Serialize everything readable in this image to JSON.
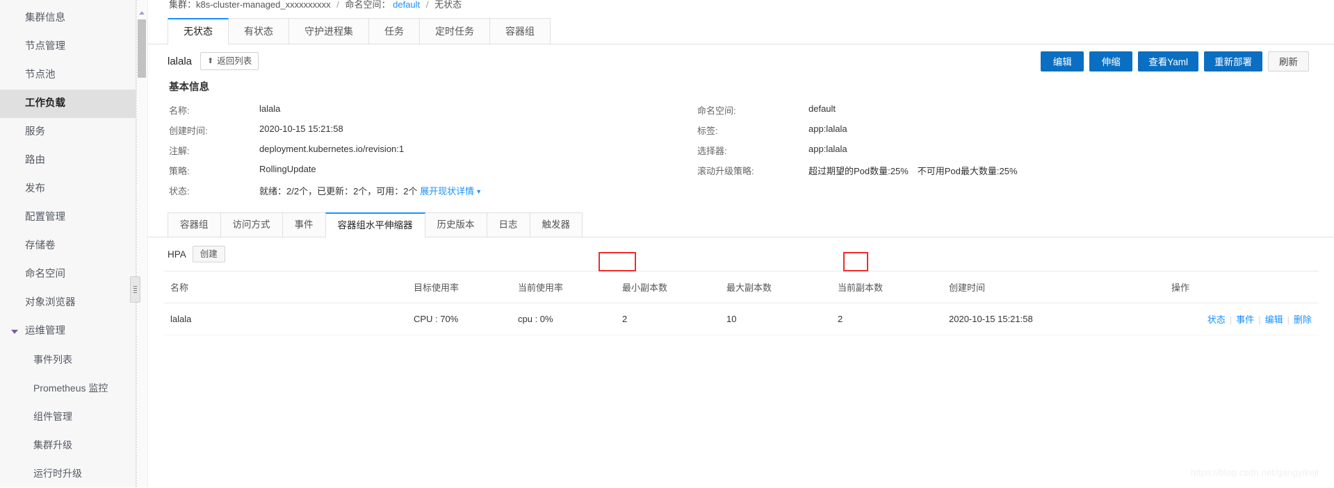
{
  "sidebar": {
    "items": [
      {
        "label": "集群信息",
        "level": "top",
        "active": false,
        "icon": null
      },
      {
        "label": "节点管理",
        "level": "top",
        "active": false,
        "icon": null
      },
      {
        "label": "节点池",
        "level": "top",
        "active": false,
        "icon": null
      },
      {
        "label": "工作负载",
        "level": "top",
        "active": true,
        "icon": null
      },
      {
        "label": "服务",
        "level": "top",
        "active": false,
        "icon": null
      },
      {
        "label": "路由",
        "level": "top",
        "active": false,
        "icon": null
      },
      {
        "label": "发布",
        "level": "top",
        "active": false,
        "icon": null
      },
      {
        "label": "配置管理",
        "level": "top",
        "active": false,
        "icon": null
      },
      {
        "label": "存储卷",
        "level": "top",
        "active": false,
        "icon": null
      },
      {
        "label": "命名空间",
        "level": "top",
        "active": false,
        "icon": null
      },
      {
        "label": "对象浏览器",
        "level": "top",
        "active": false,
        "icon": null
      },
      {
        "label": "运维管理",
        "level": "group",
        "active": false,
        "icon": "caret-down-icon"
      },
      {
        "label": "事件列表",
        "level": "child",
        "active": false,
        "icon": null
      },
      {
        "label": "Prometheus 监控",
        "level": "child",
        "active": false,
        "icon": null
      },
      {
        "label": "组件管理",
        "level": "child",
        "active": false,
        "icon": null
      },
      {
        "label": "集群升级",
        "level": "child",
        "active": false,
        "icon": null
      },
      {
        "label": "运行时升级",
        "level": "child",
        "active": false,
        "icon": null
      }
    ]
  },
  "breadcrumb": {
    "cluster": "集群：k8s-cluster-managed_xxxxxxxxxx",
    "sep1": "/",
    "namespace_label": "命名空间：",
    "namespace_link": "default",
    "sep2": "/",
    "page": "无状态"
  },
  "top_tabs": [
    {
      "label": "无状态",
      "active": true
    },
    {
      "label": "有状态",
      "active": false
    },
    {
      "label": "守护进程集",
      "active": false
    },
    {
      "label": "任务",
      "active": false
    },
    {
      "label": "定时任务",
      "active": false
    },
    {
      "label": "容器组",
      "active": false
    }
  ],
  "workload": {
    "title": "lalala",
    "back_button": "返回列表",
    "back_icon": "up-arrow-icon"
  },
  "actions": {
    "edit": "编辑",
    "scale": "伸缩",
    "view_yaml": "查看Yaml",
    "redeploy": "重新部署",
    "refresh": "刷新"
  },
  "basic_info": {
    "section_title": "基本信息",
    "left": [
      {
        "label": "名称:",
        "value": "lalala"
      },
      {
        "label": "创建时间:",
        "value": "2020-10-15 15:21:58"
      },
      {
        "label": "注解:",
        "value": "deployment.kubernetes.io/revision:1"
      },
      {
        "label": "策略:",
        "value": "RollingUpdate"
      }
    ],
    "status": {
      "label": "状态:",
      "value": "就绪：2/2个，已更新：2个，可用：2个",
      "link": "展开现状详情",
      "link_icon": "chevron-down-icon"
    },
    "right": [
      {
        "label": "命名空间:",
        "value": "default"
      },
      {
        "label": "标签:",
        "value": "app:lalala"
      },
      {
        "label": "选择器:",
        "value": "app:lalala"
      },
      {
        "label": "滚动升级策略:",
        "value": "超过期望的Pod数量:25%　不可用Pod最大数量:25%"
      }
    ]
  },
  "inner_tabs": [
    {
      "label": "容器组",
      "active": false
    },
    {
      "label": "访问方式",
      "active": false
    },
    {
      "label": "事件",
      "active": false
    },
    {
      "label": "容器组水平伸缩器",
      "active": true
    },
    {
      "label": "历史版本",
      "active": false
    },
    {
      "label": "日志",
      "active": false
    },
    {
      "label": "触发器",
      "active": false
    }
  ],
  "hpa": {
    "label": "HPA",
    "create_button": "创建",
    "columns": {
      "name": "名称",
      "target_usage": "目标使用率",
      "current_usage": "当前使用率",
      "min_replicas": "最小副本数",
      "max_replicas": "最大副本数",
      "current_replicas": "当前副本数",
      "created_at": "创建时间",
      "operations": "操作"
    },
    "rows": [
      {
        "name": "lalala",
        "target_usage": "CPU : 70%",
        "current_usage": "cpu : 0%",
        "min_replicas": "2",
        "max_replicas": "10",
        "current_replicas": "2",
        "created_at": "2020-10-15 15:21:58",
        "ops": [
          "状态",
          "事件",
          "编辑",
          "删除"
        ]
      }
    ]
  },
  "annotations": {
    "highlight_color": "#ef2b2b",
    "boxes": [
      "current_usage_cell",
      "current_replicas_cell"
    ]
  },
  "watermark": "https://blog.csdn.net/gangyikeji"
}
